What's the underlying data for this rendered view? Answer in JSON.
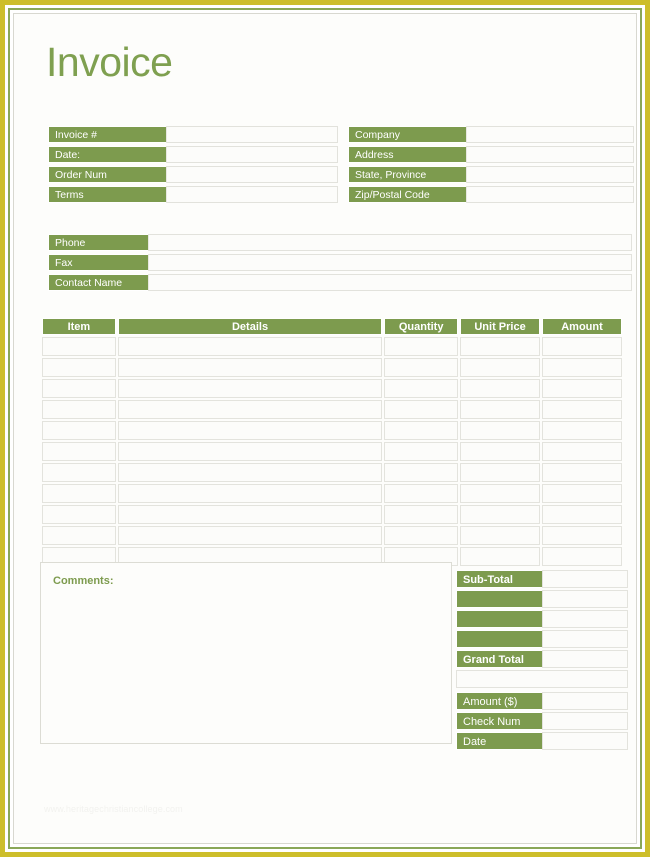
{
  "document": {
    "title": "Invoice",
    "footer_watermark": "www.heritagechristiancollege.com"
  },
  "colors": {
    "accent_green": "#7d9b4e",
    "title_green": "#7fa050",
    "border_gold": "#cdbe2a",
    "border_green": "#8aa757",
    "field_fill": "#fcfcfa",
    "field_stroke": "#e3e3dd"
  },
  "invoice_info": {
    "fields": [
      {
        "label": "Invoice #",
        "value": ""
      },
      {
        "label": "Date:",
        "value": ""
      },
      {
        "label": "Order Num",
        "value": ""
      },
      {
        "label": "Terms",
        "value": ""
      }
    ]
  },
  "bill_to": {
    "fields": [
      {
        "label": "Company",
        "value": ""
      },
      {
        "label": "Address",
        "value": ""
      },
      {
        "label": "State, Province",
        "value": ""
      },
      {
        "label": "Zip/Postal Code",
        "value": ""
      }
    ]
  },
  "contact": {
    "fields": [
      {
        "label": "Phone",
        "value": ""
      },
      {
        "label": "Fax",
        "value": ""
      },
      {
        "label": "Contact Name",
        "value": ""
      }
    ]
  },
  "items_table": {
    "columns": [
      "Item",
      "Details",
      "Quantity",
      "Unit Price",
      "Amount"
    ],
    "row_count": 11,
    "rows": [
      {
        "item": "",
        "details": "",
        "quantity": "",
        "unit_price": "",
        "amount": ""
      },
      {
        "item": "",
        "details": "",
        "quantity": "",
        "unit_price": "",
        "amount": ""
      },
      {
        "item": "",
        "details": "",
        "quantity": "",
        "unit_price": "",
        "amount": ""
      },
      {
        "item": "",
        "details": "",
        "quantity": "",
        "unit_price": "",
        "amount": ""
      },
      {
        "item": "",
        "details": "",
        "quantity": "",
        "unit_price": "",
        "amount": ""
      },
      {
        "item": "",
        "details": "",
        "quantity": "",
        "unit_price": "",
        "amount": ""
      },
      {
        "item": "",
        "details": "",
        "quantity": "",
        "unit_price": "",
        "amount": ""
      },
      {
        "item": "",
        "details": "",
        "quantity": "",
        "unit_price": "",
        "amount": ""
      },
      {
        "item": "",
        "details": "",
        "quantity": "",
        "unit_price": "",
        "amount": ""
      },
      {
        "item": "",
        "details": "",
        "quantity": "",
        "unit_price": "",
        "amount": ""
      },
      {
        "item": "",
        "details": "",
        "quantity": "",
        "unit_price": "",
        "amount": ""
      }
    ]
  },
  "comments": {
    "label": "Comments:",
    "value": ""
  },
  "totals": {
    "rows": [
      {
        "label": "Sub-Total",
        "value": "",
        "bold": true
      },
      {
        "label": "",
        "value": "",
        "bold": false
      },
      {
        "label": "",
        "value": "",
        "bold": false
      },
      {
        "label": "",
        "value": "",
        "bold": false
      },
      {
        "label": "Grand Total",
        "value": "",
        "bold": true
      }
    ]
  },
  "payment": {
    "rows": [
      {
        "label": "Amount ($)",
        "value": ""
      },
      {
        "label": "Check Num",
        "value": ""
      },
      {
        "label": "Date",
        "value": ""
      }
    ]
  }
}
